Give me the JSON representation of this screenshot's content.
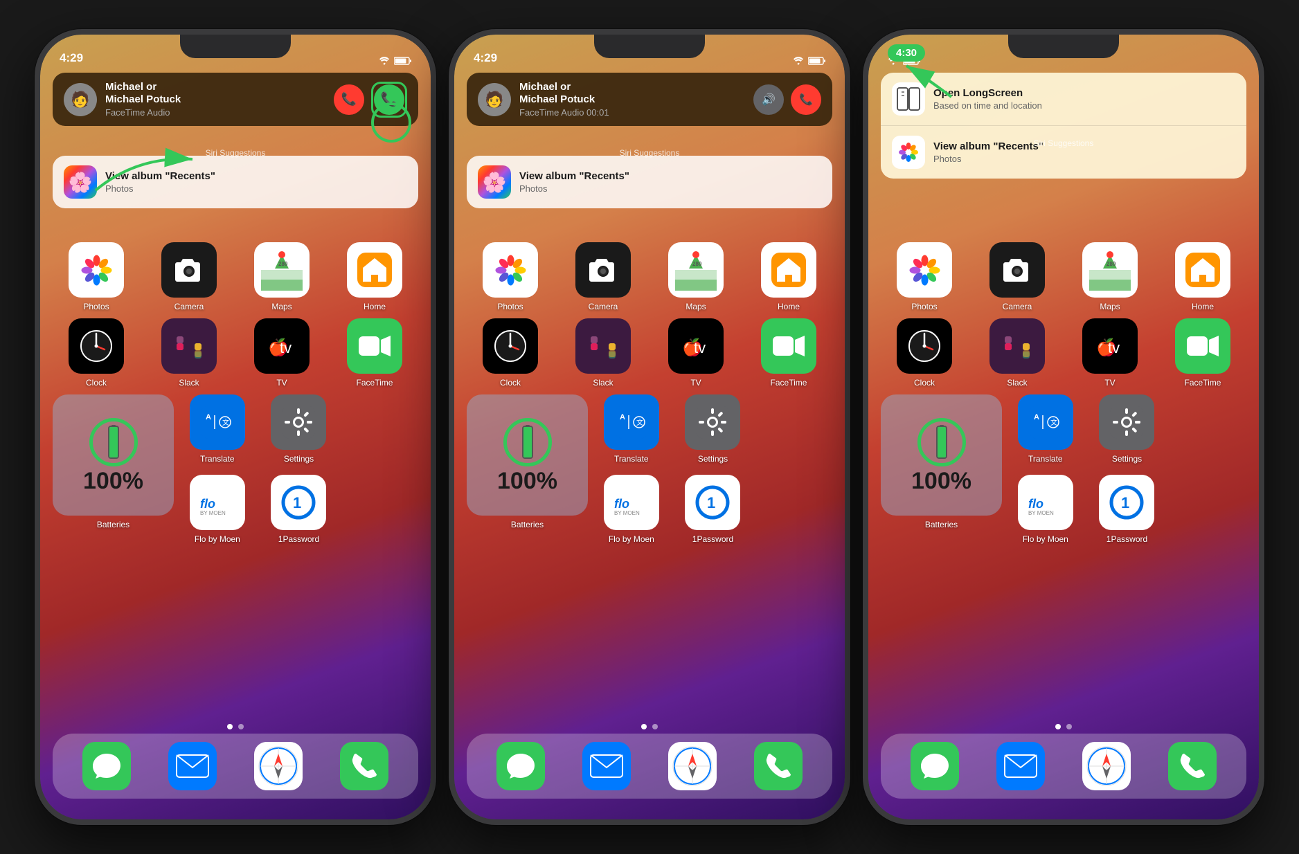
{
  "phones": [
    {
      "id": "phone1",
      "status_time": "4:29",
      "call_banner": {
        "name": "Michael or\nMichael Potuck",
        "type": "FaceTime Audio",
        "has_decline": true,
        "has_accept": true,
        "has_mute": false,
        "accept_outlined": true
      },
      "siri_label": "Siri Suggestions",
      "siri_item": {
        "icon": "📷",
        "title": "View album \"Recents\"",
        "subtitle": "Photos"
      },
      "has_green_arrow": true,
      "has_annotation_circle": true
    },
    {
      "id": "phone2",
      "status_time": "4:29",
      "call_banner": {
        "name": "Michael or\nMichael Potuck",
        "type": "FaceTime Audio 00:01",
        "has_decline": true,
        "has_accept": false,
        "has_mute": true,
        "accept_outlined": false
      },
      "siri_label": "Siri Suggestions",
      "siri_item": {
        "icon": "📷",
        "title": "View album \"Recents\"",
        "subtitle": "Photos"
      },
      "has_green_arrow": false,
      "has_annotation_circle": false
    },
    {
      "id": "phone3",
      "status_time": "4:30",
      "call_banner": null,
      "siri_label": "Siri Suggestions",
      "siri_double": {
        "items": [
          {
            "icon": "⬜",
            "title": "Open LongScreen",
            "subtitle": "Based on time and location"
          },
          {
            "icon": "📷",
            "title": "View album \"Recents\"",
            "subtitle": "Photos"
          }
        ]
      },
      "has_green_pill": true,
      "has_green_arrow": true,
      "has_annotation_circle": false
    }
  ],
  "apps_row1": [
    {
      "label": "Photos",
      "icon": "photos"
    },
    {
      "label": "Camera",
      "icon": "camera"
    },
    {
      "label": "Maps",
      "icon": "maps"
    },
    {
      "label": "Home",
      "icon": "home"
    }
  ],
  "apps_row2": [
    {
      "label": "Clock",
      "icon": "clock"
    },
    {
      "label": "Slack",
      "icon": "slack"
    },
    {
      "label": "TV",
      "icon": "tv"
    },
    {
      "label": "FaceTime",
      "icon": "facetime"
    }
  ],
  "apps_row3_right": [
    {
      "label": "Translate",
      "icon": "translate"
    },
    {
      "label": "Settings",
      "icon": "settings"
    },
    {
      "label": "Flo by Moen",
      "icon": "flo"
    },
    {
      "label": "1Password",
      "icon": "1password"
    }
  ],
  "battery_widget_label": "Batteries",
  "battery_percent": "100%",
  "dock": [
    {
      "label": "Messages",
      "icon": "messages"
    },
    {
      "label": "Mail",
      "icon": "mail"
    },
    {
      "label": "Safari",
      "icon": "safari"
    },
    {
      "label": "Phone",
      "icon": "phone"
    }
  ]
}
